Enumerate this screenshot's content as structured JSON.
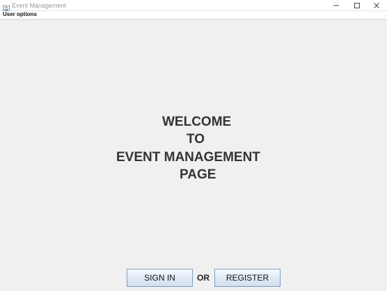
{
  "window": {
    "title": "Event Management",
    "icons": {
      "app": "java-app-icon",
      "minimize": "minimize-icon",
      "maximize": "maximize-icon",
      "close": "close-icon"
    }
  },
  "menubar": {
    "items": [
      {
        "label": "User options"
      }
    ]
  },
  "welcome": {
    "lines": [
      "WELCOME",
      "TO",
      "EVENT MANAGEMENT",
      "PAGE"
    ]
  },
  "actions": {
    "signin_label": "SIGN IN",
    "or_label": "OR",
    "register_label": "REGISTER"
  },
  "colors": {
    "background": "#f0f0f0",
    "text": "#333333",
    "button_border": "#7a9cc2"
  }
}
